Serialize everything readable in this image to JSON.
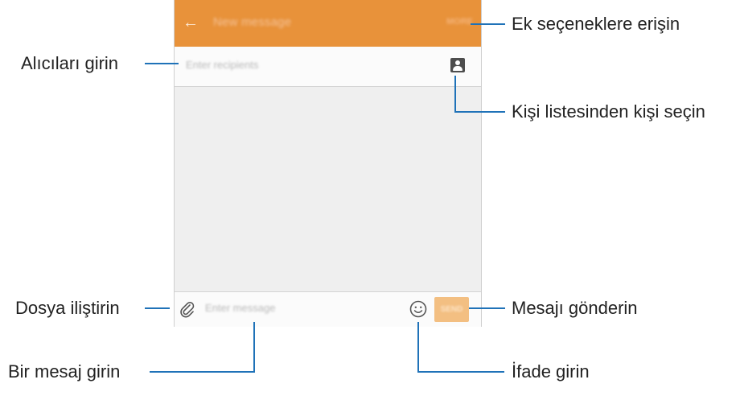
{
  "colors": {
    "appbar": "#e8923a",
    "send_button": "#f3bf82",
    "leader_line": "#1f72b8"
  },
  "app": {
    "title": "New message",
    "more_label": "MORE",
    "back_icon": "arrow-left-icon"
  },
  "recipient": {
    "placeholder": "Enter recipients",
    "contacts_icon": "contact-card-icon"
  },
  "compose": {
    "placeholder": "Enter message",
    "attach_icon": "paperclip-icon",
    "emoji_icon": "smiley-icon",
    "send_label": "SEND"
  },
  "callouts": {
    "more_options": "Ek seçeneklere erişin",
    "enter_recipients": "Alıcıları girin",
    "select_contact": "Kişi listesinden kişi seçin",
    "attach_file": "Dosya iliştirin",
    "send_message": "Mesajı gönderin",
    "enter_message": "Bir mesaj girin",
    "enter_emoticon": "İfade girin"
  }
}
